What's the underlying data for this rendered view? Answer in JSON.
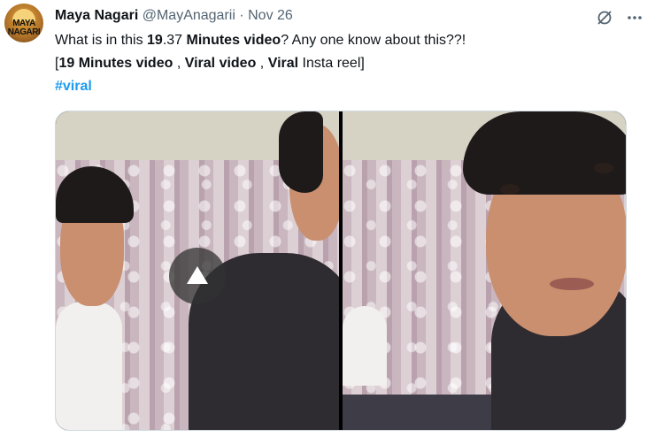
{
  "author": {
    "name": "Maya Nagari",
    "handle": "@MayAnagarii",
    "separator": "·",
    "date": "Nov 26",
    "avatar_text_line1": "MAYA",
    "avatar_text_line2": "NAGARI"
  },
  "tweet": {
    "line1_a": "What is in this ",
    "line1_b": "19",
    "line1_c": ".37 ",
    "line1_d": "Minutes video",
    "line1_e": "? Any one know about this??!",
    "line2_a": "[",
    "line2_b": "19 Minutes video",
    "line2_c": " , ",
    "line2_d": "Viral video",
    "line2_e": " , ",
    "line2_f": "Viral",
    "line2_g": " Insta reel]",
    "hashtag": "#viral"
  },
  "icons": {
    "grok": "grok-icon",
    "more": "more-icon",
    "play": "play-icon"
  },
  "colors": {
    "hashtag": "#1d9bf0",
    "secondary_text": "#536471"
  }
}
